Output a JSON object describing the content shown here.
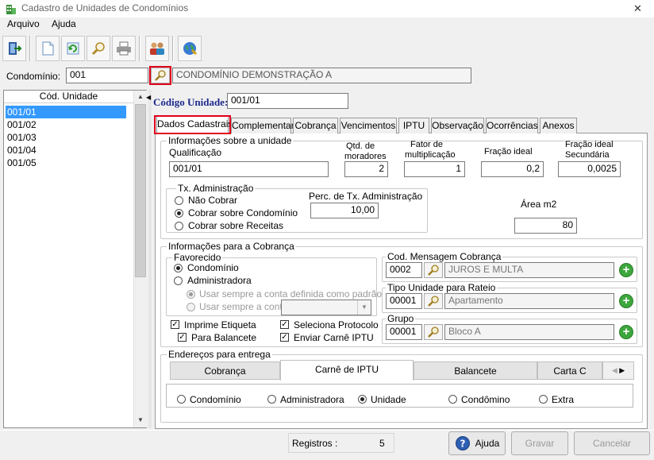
{
  "window": {
    "title": "Cadastro de Unidades de Condomínios",
    "close_glyph": "✕"
  },
  "menu": [
    "Arquivo",
    "Ajuda"
  ],
  "toolbar": {
    "icons": [
      "exit-icon",
      "new-document-icon",
      "refresh-icon",
      "search-icon",
      "print-icon",
      "users-icon",
      "globe-icon"
    ]
  },
  "condominio": {
    "label": "Condomínio:",
    "code": "001",
    "name": "CONDOMÍNIO DEMONSTRAÇÃO A"
  },
  "unit_list": {
    "header": "Cód. Unidade",
    "items": [
      "001/01",
      "001/02",
      "001/03",
      "001/04",
      "001/05"
    ],
    "selected_index": 0
  },
  "codigo_unidade": {
    "label": "Código Unidade:",
    "value": "001/01"
  },
  "tabs": [
    "Dados Cadastrais",
    "Complementar",
    "Cobrança",
    "Vencimentos",
    "IPTU",
    "Observação",
    "Ocorrências",
    "Anexos"
  ],
  "active_tab": 0,
  "info_unidade": {
    "title": "Informações sobre a unidade",
    "qualificacao_label": "Qualificação",
    "qualificacao": "001/01",
    "qtd_moradores_label_1": "Qtd. de",
    "qtd_moradores_label_2": "moradores",
    "qtd_moradores": "2",
    "fator_label_1": "Fator de",
    "fator_label_2": "multiplicação",
    "fator": "1",
    "fracao_label": "Fração ideal",
    "fracao": "0,2",
    "fracao_sec_label_1": "Fração ideal",
    "fracao_sec_label_2": "Secundária",
    "fracao_sec": "0,0025",
    "tx_admin": {
      "title": "Tx. Administração",
      "options": [
        "Não Cobrar",
        "Cobrar sobre Condomínio",
        "Cobrar sobre Receitas"
      ],
      "selected": 1,
      "perc_label": "Perc. de Tx. Administração",
      "perc": "10,00"
    },
    "area_label": "Área m2",
    "area": "80"
  },
  "cobranca": {
    "title": "Informações para a Cobrança",
    "favorecido": {
      "title": "Favorecido",
      "options": [
        "Condomínio",
        "Administradora"
      ],
      "selected": 0,
      "sub_options": [
        "Usar sempre a conta definida como padrão",
        "Usar sempre a conta"
      ],
      "sub_selected": 0
    },
    "checks": [
      {
        "label": "Imprime Etiqueta",
        "checked": true
      },
      {
        "label": "Seleciona Protocolo",
        "checked": true
      },
      {
        "label": "Para Balancete",
        "checked": true
      },
      {
        "label": "Enviar Carnê IPTU",
        "checked": true
      }
    ],
    "cod_mensagem": {
      "title": "Cod. Mensagem Cobrança",
      "code": "0002",
      "desc": "JUROS E MULTA"
    },
    "tipo_unidade": {
      "title": "Tipo Unidade para Rateio",
      "code": "00001",
      "desc": "Apartamento"
    },
    "grupo": {
      "title": "Grupo",
      "code": "00001",
      "desc": "Bloco A"
    }
  },
  "enderecos": {
    "title": "Endereços para entrega",
    "tabs": [
      "Cobrança",
      "Carnê de IPTU",
      "Balancete",
      "Carta C"
    ],
    "active_tab": 1,
    "options": [
      "Condomínio",
      "Administradora",
      "Unidade",
      "Condômino",
      "Extra"
    ],
    "selected": 2
  },
  "status": {
    "registros_label": "Registros :",
    "registros": "5",
    "ajuda": "Ajuda",
    "gravar": "Gravar",
    "cancelar": "Cancelar"
  }
}
